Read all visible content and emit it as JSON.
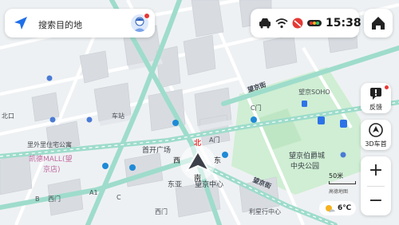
{
  "search": {
    "placeholder": "搜索目的地"
  },
  "status": {
    "time": "15:38"
  },
  "side": {
    "feedback_label": "反馈",
    "view3d_label": "3D车首"
  },
  "scale": {
    "label": "50米",
    "credit": "高德地图"
  },
  "weather": {
    "temp": "6℃"
  },
  "compass": {
    "north": "北",
    "south": "南",
    "west": "西",
    "east": "东"
  },
  "map_labels": {
    "wangjing_st": "望京街",
    "wangjing_st2": "望京街",
    "wangjing_soho": "望京SOHO",
    "wangjing_park": "望京伯爵城",
    "central_park": "中央公园",
    "shoukai_square": "首开广场",
    "dongya": "东亚",
    "wangjing_center": "望京中心",
    "liyuan_center": "利星行中心",
    "kaide_mall1": "凯德MALL(望",
    "kaide_mall2": "京店)",
    "lixin_apt": "里外里住宅公寓",
    "north_exit": "北口",
    "gate_a": "A门",
    "gate_c": "C门",
    "exit_a1": "A1",
    "exit_c": "C",
    "exit_b": "B",
    "west_gate": "西门",
    "west_gate2": "西门",
    "bus_stop": "车站"
  },
  "colors": {
    "accent": "#1f6fe8",
    "road_main": "#8fd7c2",
    "park": "#c9e8cc",
    "notify_red": "#e53935"
  }
}
